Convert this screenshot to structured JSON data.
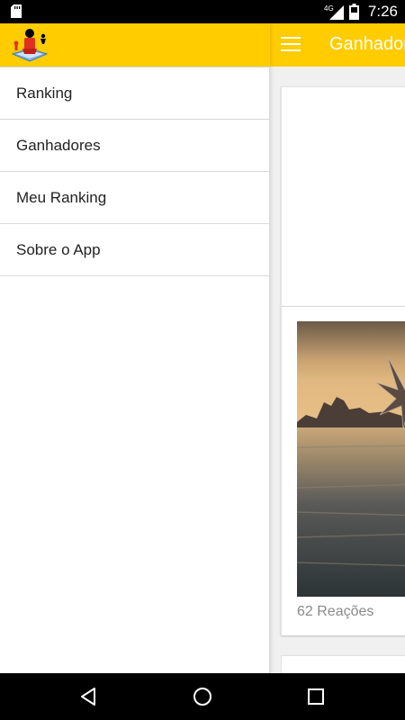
{
  "status_bar": {
    "network": "4G",
    "time": "7:26",
    "icons": [
      "sd-card-icon",
      "signal-icon",
      "battery-icon"
    ]
  },
  "app_bar": {
    "title": "Ganhadores",
    "background": "#ffcc00",
    "menu_icon": "hamburger-menu-icon"
  },
  "drawer": {
    "logo_icon": "app-logo-icon",
    "items": [
      {
        "label": "Ranking"
      },
      {
        "label": "Ganhadores"
      },
      {
        "label": "Meu Ranking"
      },
      {
        "label": "Sobre o App"
      }
    ]
  },
  "feed": {
    "post": {
      "reactions": "62 Reações"
    }
  },
  "nav_bar": {
    "icons": [
      "back-icon",
      "home-icon",
      "recents-icon"
    ]
  },
  "colors": {
    "accent": "#ffcc00",
    "divider": "#d9d9d9",
    "secondary_text": "#8a8a8a"
  }
}
